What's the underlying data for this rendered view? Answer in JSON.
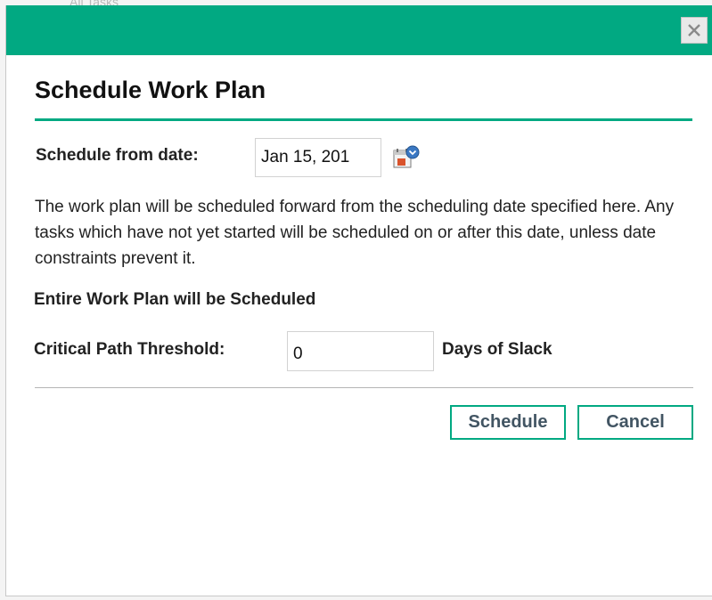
{
  "background": {
    "peek_text": "All Tasks"
  },
  "dialog": {
    "title": "Schedule Work Plan",
    "close_icon": "close-icon",
    "schedule_from_label": "Schedule from date:",
    "schedule_from_value": "Jan 15, 201",
    "calendar_icon": "calendar-icon",
    "description": "The work plan will be scheduled forward from the scheduling date specified here. Any tasks which have not yet started will be scheduled on or after this date, unless date constraints prevent it.",
    "scope_note": "Entire Work Plan will be Scheduled",
    "threshold_label": "Critical Path Threshold:",
    "threshold_value": "0",
    "threshold_unit": "Days of Slack",
    "schedule_button": "Schedule",
    "cancel_button": "Cancel"
  },
  "colors": {
    "accent": "#01a982",
    "button_text": "#425563",
    "calendar_blue": "#3a78c3",
    "calendar_red": "#d9532c"
  }
}
